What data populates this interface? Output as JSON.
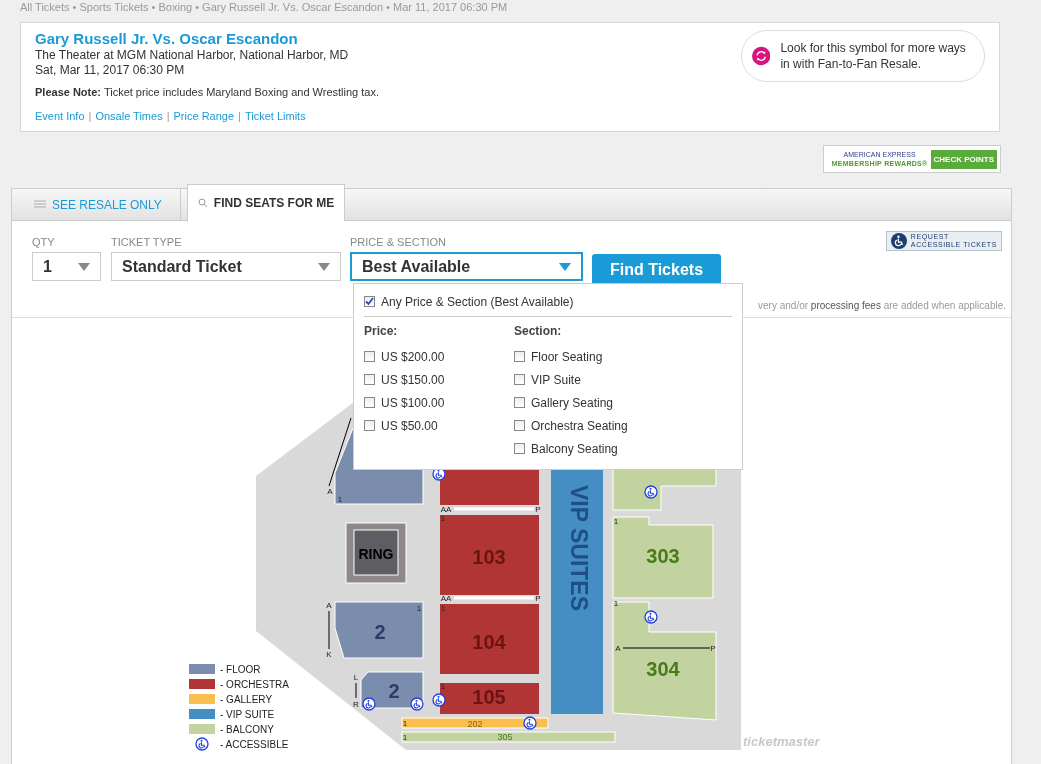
{
  "breadcrumb": "All Tickets • Sports Tickets • Boxing • Gary Russell Jr. Vs. Oscar Escandon • Mar 11, 2017 06:30 PM",
  "event": {
    "title": "Gary Russell Jr. Vs. Oscar Escandon",
    "venue": "The Theater at MGM National Harbor, National Harbor, MD",
    "date": "Sat, Mar 11, 2017 06:30 PM",
    "note": "**Please Note:** Ticket price includes Maryland Boxing and Wrestling tax.",
    "links": [
      "Event Info",
      "Onsale Times",
      "Price Range",
      "Ticket Limits"
    ],
    "link_separator": "|",
    "resale_hint": "Look for this symbol for more ways in with Fan-to-Fan Resale."
  },
  "amex": {
    "brand": "AMERICAN EXPRESS",
    "program": "MEMBERSHIP REWARDS®",
    "button": "CHECK POINTS"
  },
  "tabs": [
    {
      "label": "SEE RESALE ONLY",
      "selected": false
    },
    {
      "label": "FIND SEATS FOR ME",
      "selected": true
    }
  ],
  "filters": {
    "qty": {
      "label": "QTY",
      "value": "1"
    },
    "ticket_type": {
      "label": "TICKET TYPE",
      "value": "Standard Ticket"
    },
    "price_section": {
      "label": "PRICE & SECTION",
      "value": "Best Available",
      "expanded": true
    },
    "find_button": "Find Tickets",
    "accessible_button": [
      "REQUEST",
      "ACCESSIBLE TICKETS"
    ],
    "fees_note": "very and/or **processing fees** are added when applicable."
  },
  "dropdown": {
    "any": {
      "label": "Any Price & Section (Best Available)",
      "checked": true
    },
    "price_heading": "Price:",
    "section_heading": "Section:",
    "prices": [
      {
        "label": "US $200.00",
        "checked": false
      },
      {
        "label": "US $150.00",
        "checked": false
      },
      {
        "label": "US $100.00",
        "checked": false
      },
      {
        "label": "US $50.00",
        "checked": false
      }
    ],
    "sections": [
      {
        "label": "Floor Seating",
        "checked": false
      },
      {
        "label": "VIP Suite",
        "checked": false
      },
      {
        "label": "Gallery Seating",
        "checked": false
      },
      {
        "label": "Orchestra Seating",
        "checked": false
      },
      {
        "label": "Balcony Seating",
        "checked": false
      }
    ]
  },
  "seat_map": {
    "ring": "RING",
    "vip": "VIP SUITES",
    "section_labels": [
      "2",
      "2",
      "103",
      "104",
      "105",
      "303",
      "304",
      "202",
      "305"
    ],
    "row_marks": [
      "A",
      "1",
      "A",
      "K",
      "1",
      "L",
      "R",
      "AA",
      "P",
      "1",
      "AA",
      "P",
      "1",
      "1",
      "1",
      "1",
      "A",
      "P",
      "1",
      "1"
    ],
    "logo": "ticketmaster"
  },
  "legend": [
    {
      "label": "- FLOOR",
      "kind": "swatch",
      "color": "#7b8dac"
    },
    {
      "label": "- ORCHESTRA",
      "kind": "swatch",
      "color": "#b23535"
    },
    {
      "label": "- GALLERY",
      "kind": "swatch",
      "color": "#fbbf4f"
    },
    {
      "label": "- VIP SUITE",
      "kind": "swatch",
      "color": "#448ec3"
    },
    {
      "label": "- BALCONY",
      "kind": "swatch",
      "color": "#c3d3a0"
    },
    {
      "label": "- ACCESSIBLE",
      "kind": "icon"
    }
  ]
}
